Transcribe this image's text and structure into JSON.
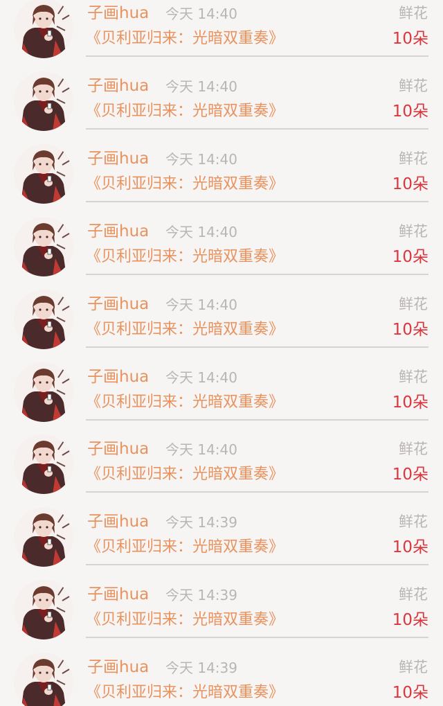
{
  "records": [
    {
      "user": "子画hua",
      "time": "今天 14:40",
      "gift": "鲜花",
      "book": "《贝利亚归来：光暗双重奏》",
      "count": "10朵"
    },
    {
      "user": "子画hua",
      "time": "今天 14:40",
      "gift": "鲜花",
      "book": "《贝利亚归来：光暗双重奏》",
      "count": "10朵"
    },
    {
      "user": "子画hua",
      "time": "今天 14:40",
      "gift": "鲜花",
      "book": "《贝利亚归来：光暗双重奏》",
      "count": "10朵"
    },
    {
      "user": "子画hua",
      "time": "今天 14:40",
      "gift": "鲜花",
      "book": "《贝利亚归来：光暗双重奏》",
      "count": "10朵"
    },
    {
      "user": "子画hua",
      "time": "今天 14:40",
      "gift": "鲜花",
      "book": "《贝利亚归来：光暗双重奏》",
      "count": "10朵"
    },
    {
      "user": "子画hua",
      "time": "今天 14:40",
      "gift": "鲜花",
      "book": "《贝利亚归来：光暗双重奏》",
      "count": "10朵"
    },
    {
      "user": "子画hua",
      "time": "今天 14:40",
      "gift": "鲜花",
      "book": "《贝利亚归来：光暗双重奏》",
      "count": "10朵"
    },
    {
      "user": "子画hua",
      "time": "今天 14:39",
      "gift": "鲜花",
      "book": "《贝利亚归来：光暗双重奏》",
      "count": "10朵"
    },
    {
      "user": "子画hua",
      "time": "今天 14:39",
      "gift": "鲜花",
      "book": "《贝利亚归来：光暗双重奏》",
      "count": "10朵"
    },
    {
      "user": "子画hua",
      "time": "今天 14:39",
      "gift": "鲜花",
      "book": "《贝利亚归来：光暗双重奏》",
      "count": "10朵"
    }
  ],
  "colors": {
    "background": "#f7f4f4",
    "accent_orange": "#e8925e",
    "muted_gray": "#b9b5b5",
    "count_red": "#d9363e",
    "divider": "#d6d3d3"
  },
  "icons": {
    "avatar": "anime-avatar-icon"
  }
}
